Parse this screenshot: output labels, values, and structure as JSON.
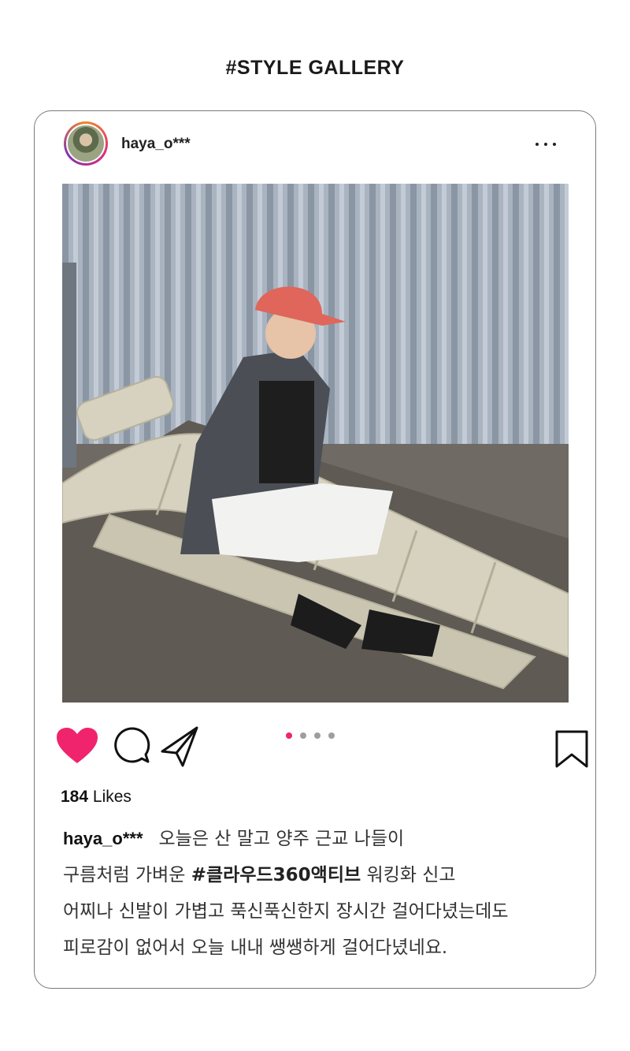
{
  "page": {
    "title": "#STYLE GALLERY"
  },
  "post": {
    "username": "haya_o***",
    "avatar_icon": "avatar",
    "more_icon": "more-horizontal-icon",
    "photo_alt": "",
    "carousel": {
      "count": 4,
      "active_index": 0,
      "active_color": "#f0246c"
    },
    "actions": {
      "like_icon": "heart-icon",
      "like_color": "#f0246c",
      "comment_icon": "comment-icon",
      "share_icon": "send-icon",
      "save_icon": "bookmark-icon"
    },
    "likes_count": "184",
    "likes_label": "Likes",
    "caption": {
      "user": "haya_o***",
      "line1": "오늘은 산 말고 양주 근교 나들이",
      "line2_prefix": "구름처럼 가벼운 ",
      "line2_tag": "#클라우드360액티브",
      "line2_suffix": " 워킹화 신고",
      "line3": "어찌나 신발이 가볍고 푹신푹신한지 장시간 걸어다녔는데도",
      "line4": "피로감이 없어서 오늘 내내 쌩쌩하게 걸어다녔네요."
    }
  }
}
